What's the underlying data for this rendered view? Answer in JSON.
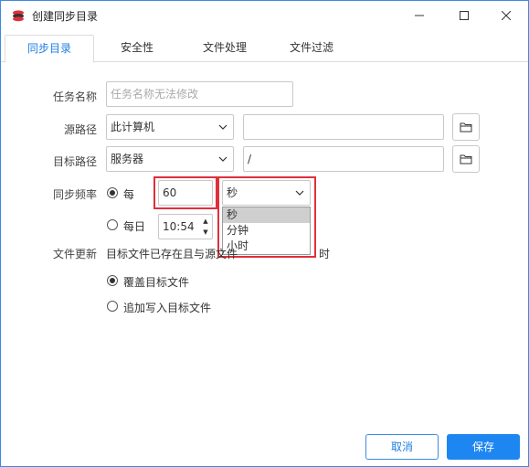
{
  "window": {
    "title": "创建同步目录"
  },
  "tabs": [
    "同步目录",
    "安全性",
    "文件处理",
    "文件过滤"
  ],
  "form": {
    "task_name_label": "任务名称",
    "task_name_placeholder": "任务名称无法修改",
    "source_label": "源路径",
    "source_select": "此计算机",
    "source_path": "",
    "target_label": "目标路径",
    "target_select": "服务器",
    "target_path": "/",
    "frequency_label": "同步频率",
    "every_label": "每",
    "every_value": "60",
    "unit_selected": "秒",
    "unit_options": [
      "秒",
      "分钟",
      "小时"
    ],
    "daily_label": "每日",
    "daily_time": "10:54",
    "update_label": "文件更新",
    "update_desc": "目标文件已存在且与源文件",
    "update_desc_tail": "时",
    "overwrite_label": "覆盖目标文件",
    "append_label": "追加写入目标文件"
  },
  "buttons": {
    "cancel": "取消",
    "save": "保存"
  },
  "colors": {
    "accent": "#1e86f0",
    "highlight": "#e0303a"
  }
}
